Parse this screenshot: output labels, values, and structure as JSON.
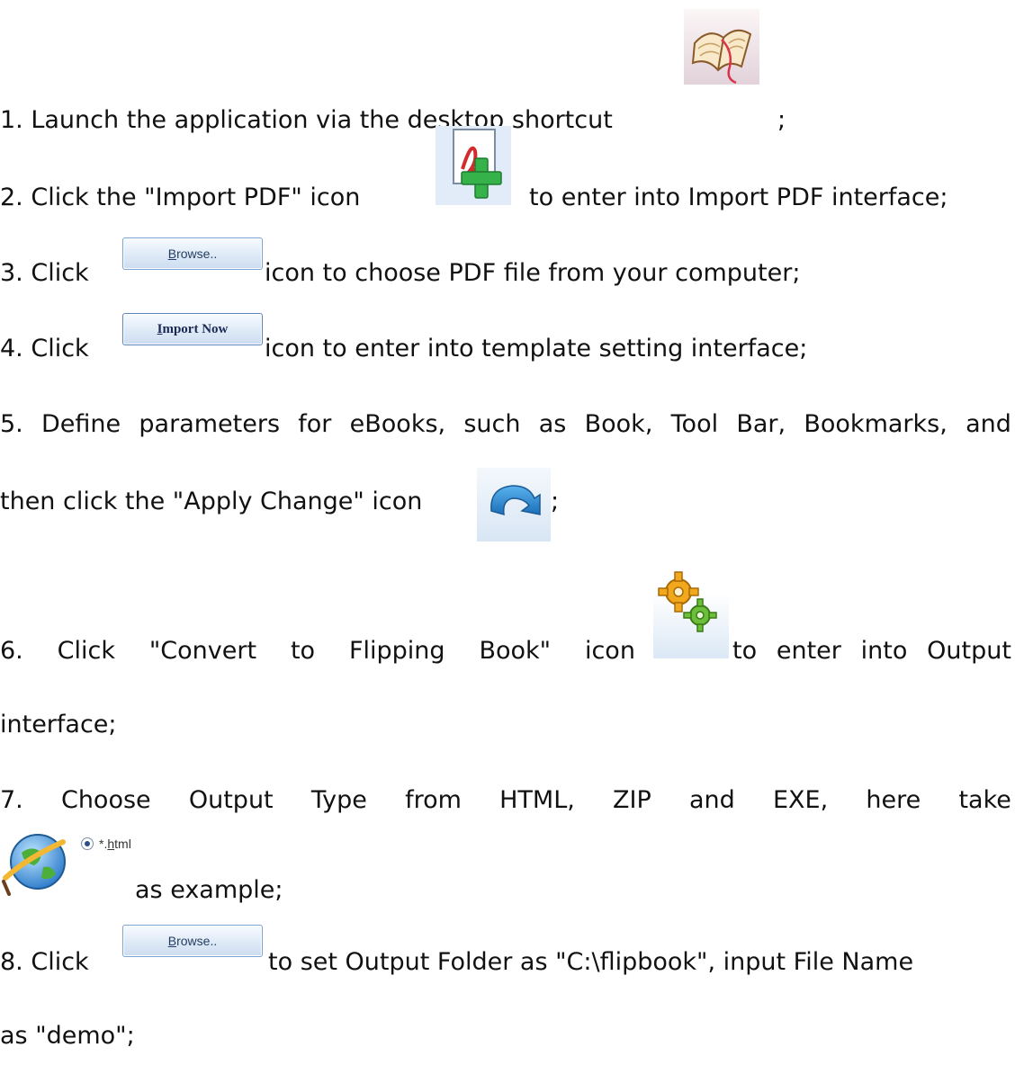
{
  "steps": {
    "s1": {
      "text": "1. Launch the application via the desktop shortcut",
      "tail": ";"
    },
    "s2": {
      "pre": "2. Click the \"Import PDF\" icon",
      "post": "to enter into Import PDF interface;"
    },
    "s3": {
      "pre": "3. Click",
      "post": "icon to choose PDF file from your computer;"
    },
    "s4": {
      "pre": "4. Click",
      "post": "icon to enter into template setting interface;"
    },
    "s5": {
      "line1": [
        "5.",
        "Define",
        "parameters",
        "for",
        "eBooks,",
        "such",
        "as",
        "Book,",
        "Tool",
        "Bar,",
        "Bookmarks,",
        "and"
      ],
      "line2": "then click the \"Apply Change\" icon",
      "tail": ";"
    },
    "s6": {
      "line1a": [
        "6.",
        "Click",
        "\"Convert",
        "to",
        "Flipping",
        "Book\"",
        "icon"
      ],
      "line1b": [
        "to",
        "enter",
        "into",
        "Output"
      ],
      "line2": "interface;"
    },
    "s7": {
      "line1": [
        "7.",
        "Choose",
        "Output",
        "Type",
        "from",
        "HTML,",
        "ZIP",
        "and",
        "EXE,",
        "here",
        "take"
      ],
      "line2": "as example;"
    },
    "s8": {
      "pre": "8. Click",
      "post": "to set Output Folder as \"C:\\flipbook\", input File Name",
      "line2": "as \"demo\";"
    }
  },
  "buttons": {
    "browse_label": "Browse..",
    "browse_mnemonic": "B",
    "browse_rest": "rowse..",
    "import_now_label": "Import Now",
    "import_now_mnemonic": "I",
    "import_now_rest": "mport Now"
  },
  "radio": {
    "label_prefix": "*.",
    "label_mnemonic": "h",
    "label_rest": "tml",
    "selected": true
  },
  "icons": {
    "desktop_shortcut": "open-book-icon",
    "import_pdf": "pdf-add-icon",
    "apply_change": "apply-change-icon",
    "convert": "gears-icon",
    "html_output": "globe-icon"
  }
}
